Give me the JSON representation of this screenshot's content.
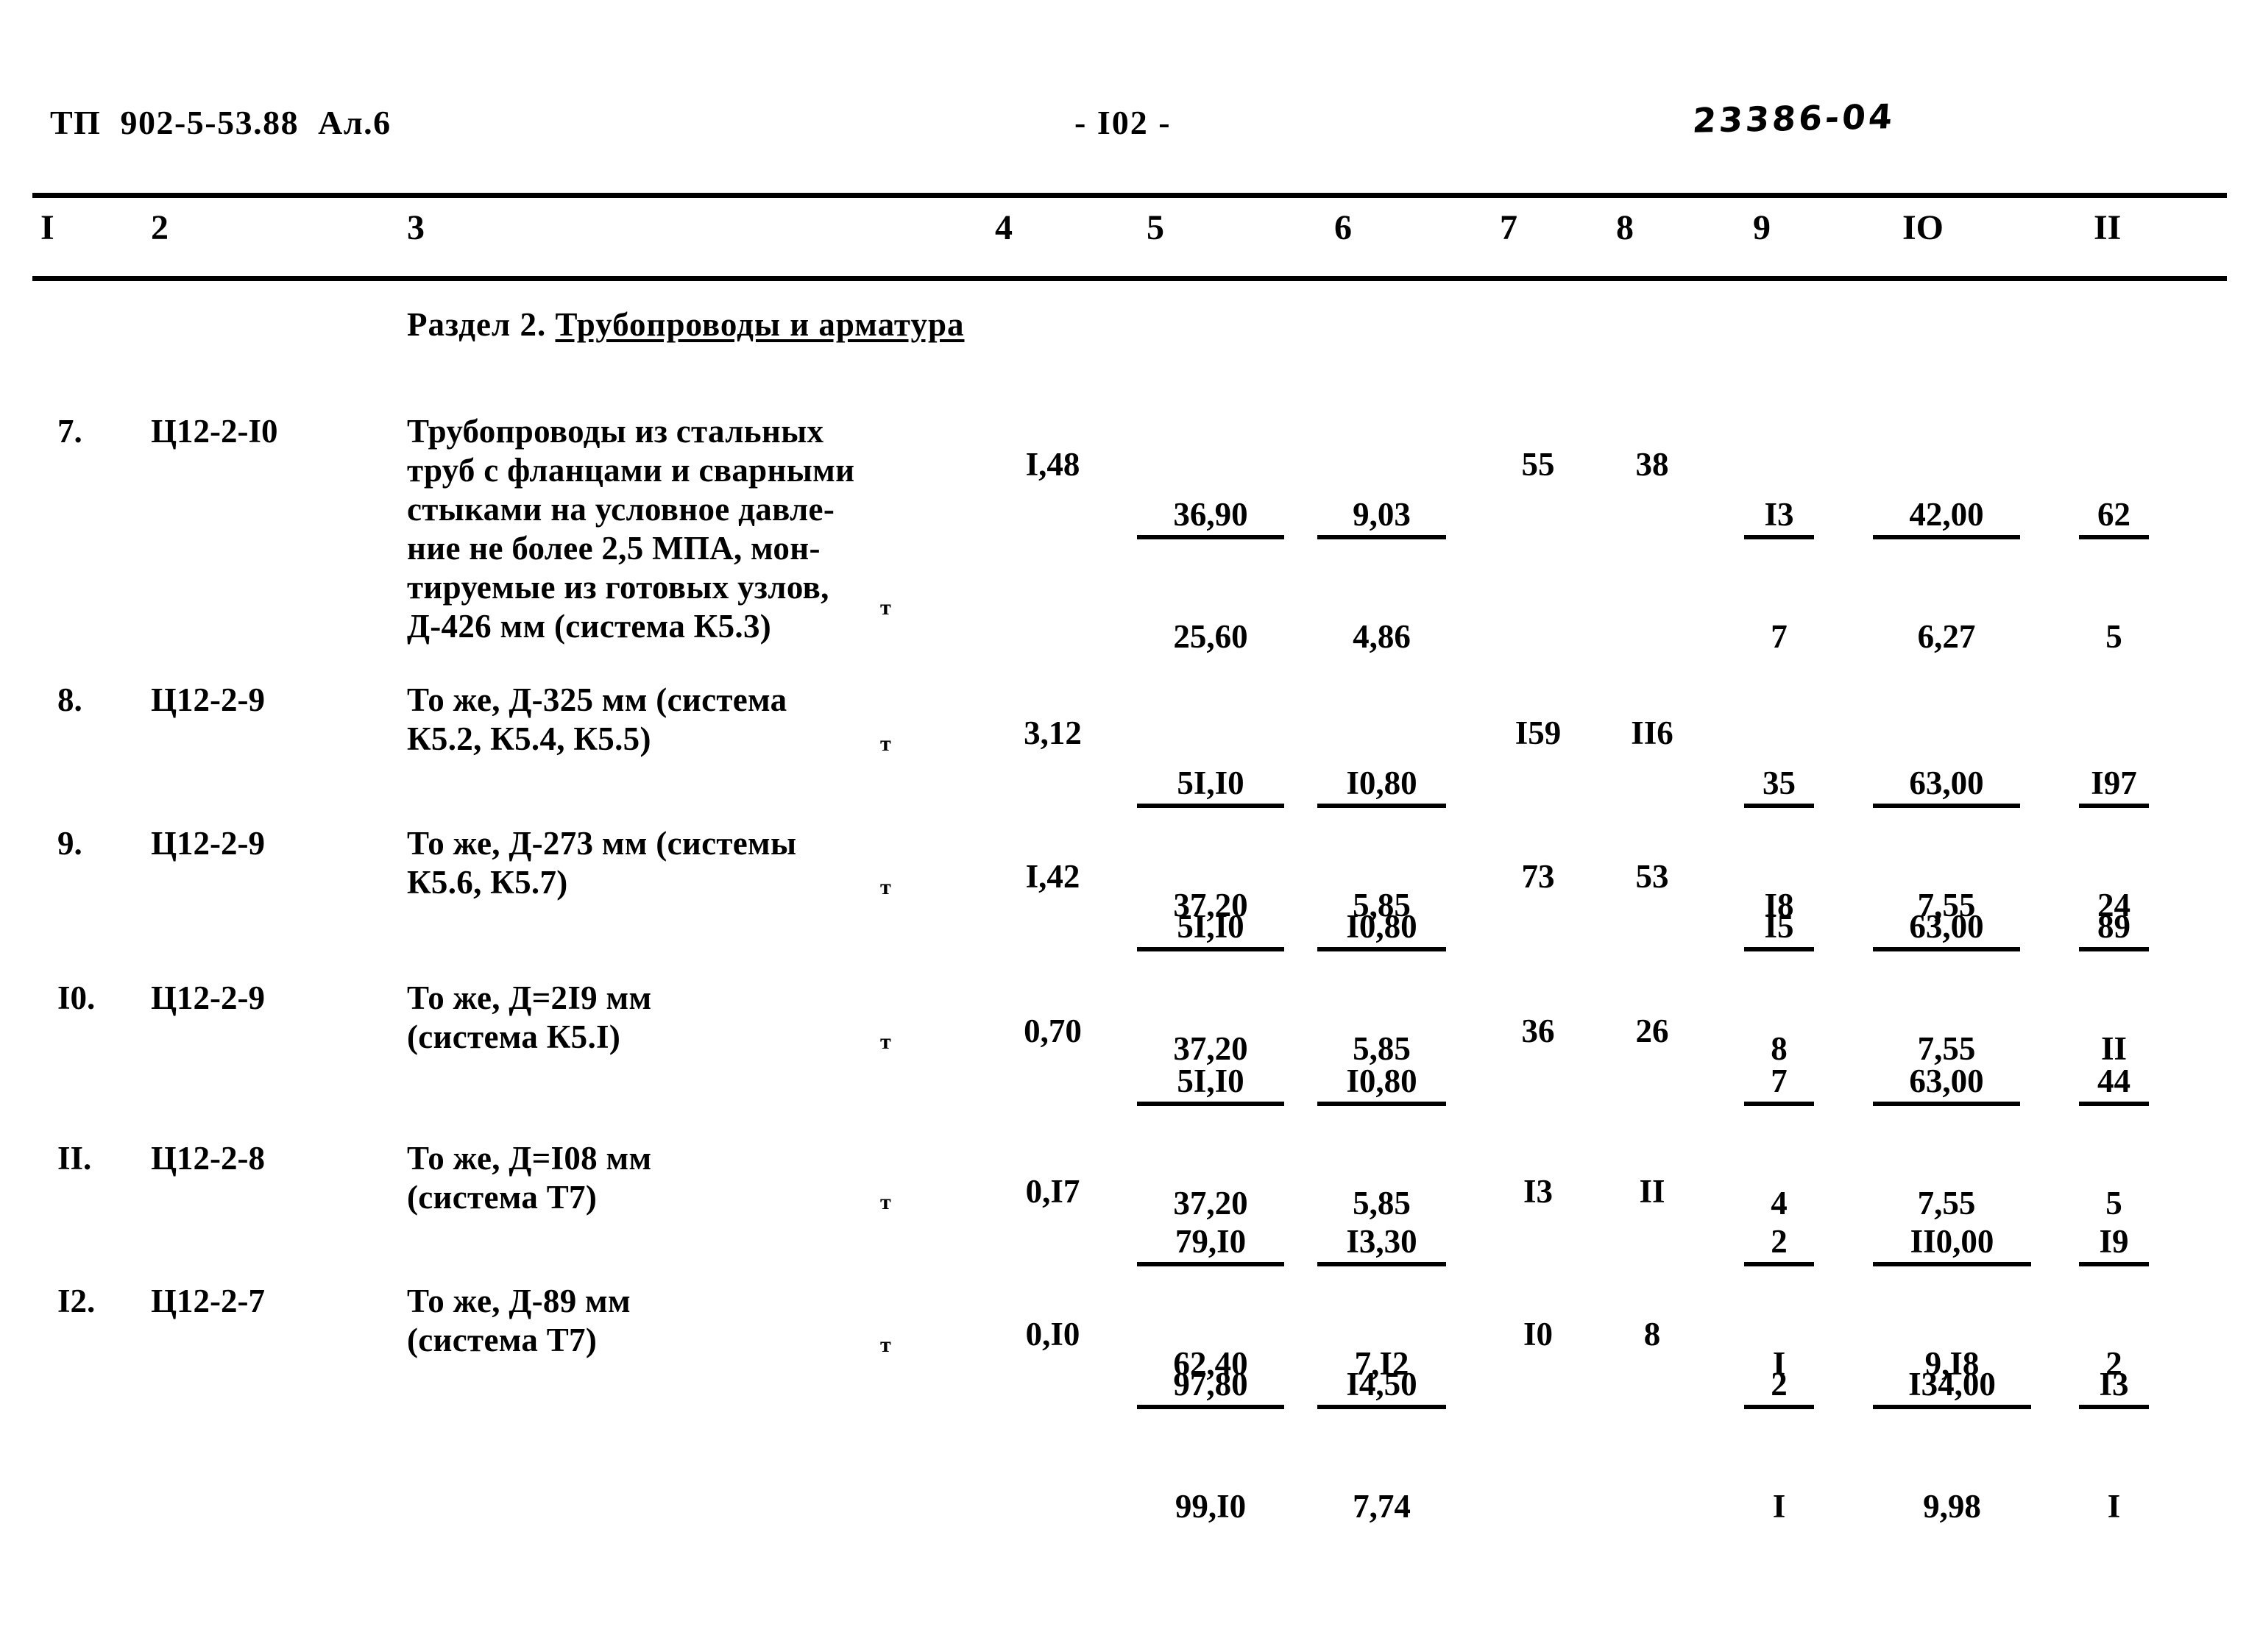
{
  "header": {
    "doc_code": "ТП  902-5-53.88  Ал.6",
    "page_number": "- I02 -",
    "handwritten_code": "23386-04"
  },
  "table": {
    "column_numbers": [
      "I",
      "2",
      "3",
      "4",
      "5",
      "6",
      "7",
      "8",
      "9",
      "IO",
      "II"
    ],
    "section_title_prefix": "Раздел 2. ",
    "section_title_underlined": "Трубопроводы и арматура",
    "unit_marker": "т",
    "rows": [
      {
        "num": "7.",
        "code": "Ц12-2-I0",
        "description": "Трубопроводы из стальных\nтруб с фланцами и сварными\nстыками на условное давле-\nние не более 2,5 МПА, мон-\nтируемые из готовых узлов,\nД-426 мм (система К5.3)",
        "unit": "т",
        "c4": "I,48",
        "c5_top": "36,90",
        "c5_bot": "25,60",
        "c6_top": "9,03",
        "c6_bot": "4,86",
        "c7": "55",
        "c8": "38",
        "c9_top": "I3",
        "c9_bot": "7",
        "c10_top": "42,00",
        "c10_bot": "6,27",
        "c11_top": "62",
        "c11_bot": "5"
      },
      {
        "num": "8.",
        "code": "Ц12-2-9",
        "description": "То же, Д-325 мм (система\nК5.2, К5.4, К5.5)",
        "unit": "т",
        "c4": "3,12",
        "c5_top": "5I,I0",
        "c5_bot": "37,20",
        "c6_top": "I0,80",
        "c6_bot": "5,85",
        "c7": "I59",
        "c8": "II6",
        "c9_top": "35",
        "c9_bot": "I8",
        "c10_top": "63,00",
        "c10_bot": "7,55",
        "c11_top": "I97",
        "c11_bot": "24"
      },
      {
        "num": "9.",
        "code": "Ц12-2-9",
        "description": "То же, Д-273 мм (системы\nК5.6, К5.7)",
        "unit": "т",
        "c4": "I,42",
        "c5_top": "5I,I0",
        "c5_bot": "37,20",
        "c6_top": "I0,80",
        "c6_bot": "5,85",
        "c7": "73",
        "c8": "53",
        "c9_top": "I5",
        "c9_bot": "8",
        "c10_top": "63,00",
        "c10_bot": "7,55",
        "c11_top": "89",
        "c11_bot": "II"
      },
      {
        "num": "I0.",
        "code": "Ц12-2-9",
        "description": "То же, Д=2I9 мм\n(система К5.I)",
        "unit": "т",
        "c4": "0,70",
        "c5_top": "5I,I0",
        "c5_bot": "37,20",
        "c6_top": "I0,80",
        "c6_bot": "5,85",
        "c7": "36",
        "c8": "26",
        "c9_top": "7",
        "c9_bot": "4",
        "c10_top": "63,00",
        "c10_bot": "7,55",
        "c11_top": "44",
        "c11_bot": "5"
      },
      {
        "num": "II.",
        "code": "Ц12-2-8",
        "description": "То же, Д=I08 мм\n(система Т7)",
        "unit": "т",
        "c4": "0,I7",
        "c5_top": "79,I0",
        "c5_bot": "62,40",
        "c6_top": "I3,30",
        "c6_bot": "7,I2",
        "c7": "I3",
        "c8": "II",
        "c9_top": "2",
        "c9_bot": "I",
        "c10_top": "II0,00",
        "c10_bot": "9,I8",
        "c11_top": "I9",
        "c11_bot": "2"
      },
      {
        "num": "I2.",
        "code": "Ц12-2-7",
        "description": "То же, Д-89 мм\n(система Т7)",
        "unit": "т",
        "c4": "0,I0",
        "c5_top": "97,80",
        "c5_bot": "99,I0",
        "c6_top": "I4,50",
        "c6_bot": "7,74",
        "c7": "I0",
        "c8": "8",
        "c9_top": "2",
        "c9_bot": "I",
        "c10_top": "I34,00",
        "c10_bot": "9,98",
        "c11_top": "I3",
        "c11_bot": "I"
      }
    ]
  }
}
